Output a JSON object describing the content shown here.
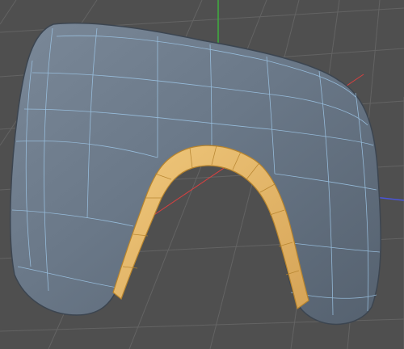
{
  "viewport": {
    "view": "perspective",
    "grid": true,
    "axes": [
      "x",
      "y",
      "z"
    ]
  },
  "colors": {
    "background": "#4f4f4f",
    "grid_line": "#666666",
    "mesh_fill": "#6e7c8c",
    "mesh_shade": "#56616e",
    "wireframe": "#9ec7e8",
    "selection_fill": "#e3b86a",
    "selection_edge": "#c48a2a",
    "axis_x": "#d94040",
    "axis_y": "#3fae3f",
    "axis_z": "#4a55d8"
  },
  "object": {
    "shape": "controller-body",
    "display": "polygons-with-wireframe",
    "selection": "inner-loop-faces"
  }
}
